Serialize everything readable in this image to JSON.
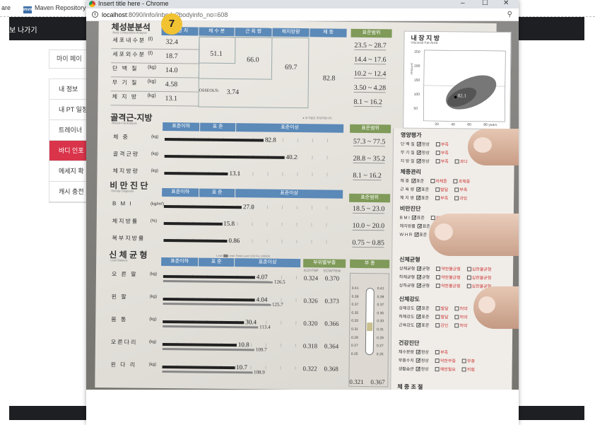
{
  "background_page": {
    "bookmarks": [
      "are",
      "Maven Repository"
    ],
    "maven_icon_text": "mvn",
    "nav_text": "보 나가기",
    "my_page": "마이 페이",
    "menu": [
      {
        "label": "내 정보",
        "active": false
      },
      {
        "label": "내 PT 일정",
        "active": false
      },
      {
        "label": "트레이너",
        "active": false
      },
      {
        "label": "바디 인포",
        "active": true
      },
      {
        "label": "메세지 확",
        "active": false
      },
      {
        "label": "캐시 충전",
        "active": false
      }
    ]
  },
  "popup": {
    "window_title": "Insert title here - Chrome",
    "window_controls": [
      "–",
      "☐",
      "✕"
    ],
    "url_host": "localhost",
    "url_path": ":8090/info/inbody?bodyinfo_no=608",
    "badge": "7"
  },
  "sheet": {
    "body_composition": {
      "title": "체성분분석",
      "subtitle": "Body Composition Analysis",
      "headers": [
        "측 정 치",
        "체 수 분",
        "근 육 량",
        "체지방량",
        "체 중",
        "표준범위"
      ],
      "rows": [
        {
          "label": "세포내수분",
          "unit": "(ℓ)",
          "value": "32.4"
        },
        {
          "label": "세포외수분",
          "unit": "(ℓ)",
          "value": "18.7"
        },
        {
          "label": "단 백 질",
          "unit": "(kg)",
          "value": "14.0"
        },
        {
          "label": "무 기 질",
          "unit": "(kg)",
          "value": "4.58"
        },
        {
          "label": "체 지 방",
          "unit": "(kg)",
          "value": "13.1"
        }
      ],
      "water": "51.1",
      "muscle": "66.0",
      "fat_free": "69.7",
      "weight": "82.8",
      "osseous_label": "OSSEOUS:",
      "osseous": "3.74",
      "ranges": [
        "23.5 ~ 28.7",
        "14.4 ~ 17.6",
        "10.2 ~ 12.4",
        "3.50 ~ 4.28",
        "8.1 ~ 16.2"
      ]
    },
    "muscle_fat": {
      "title": "골격근-지방",
      "subtitle": "Muscle-Fat Analysis",
      "headers": [
        "표준이하",
        "표 준",
        "표준이상",
        "표준범위"
      ],
      "note": "● 부가질은 추정치입니다.",
      "rows": [
        {
          "label": "체 중",
          "unit": "(kg)",
          "value": "82.8",
          "fill": 0.56,
          "range": "57.3 ~ 77.5"
        },
        {
          "label": "골격근량",
          "unit": "(kg)",
          "value": "40.2",
          "fill": 0.68,
          "range": "28.8 ~ 35.2"
        },
        {
          "label": "체지방량",
          "unit": "(kg)",
          "value": "13.1",
          "fill": 0.36,
          "range": "8.1 ~ 16.2"
        }
      ]
    },
    "obesity": {
      "title": "비 만 진 단",
      "subtitle": "Obesity Diagnosis",
      "headers": [
        "표준이하",
        "표 준",
        "표준이상",
        "표준범위"
      ],
      "rows": [
        {
          "label": "B M I",
          "unit": "(kg/m²)",
          "value": "27.0",
          "fill": 0.44,
          "range": "18.5 ~ 23.0"
        },
        {
          "label": "체지방률",
          "unit": "(%)",
          "value": "15.8",
          "fill": 0.33,
          "range": "10.0 ~ 20.0"
        },
        {
          "label": "복부지방률",
          "unit": "",
          "value": "0.86",
          "fill": 0.36,
          "range": "0.75 ~ 0.85"
        }
      ]
    },
    "balance": {
      "title": "신 체 균 형",
      "subtitle": "Lean Balance",
      "headers": [
        "표준이하",
        "표 준",
        "표준이상",
        "부위별부종",
        "부 종"
      ],
      "legend": "Lean ▇▇ Lean Total Lean+100 Fix 100000",
      "col_labels": [
        "ECF/TBF",
        "ECW/TBW"
      ],
      "rows": [
        {
          "label": "오 른 팔",
          "unit": "(kg)",
          "value": "4.07",
          "value2": "126.5",
          "fill": 0.52,
          "fill2": 0.62,
          "ecf": "0.324",
          "ecw": "0.370"
        },
        {
          "label": "왼 팔",
          "unit": "(kg)",
          "value": "4.04",
          "value2": "125.7",
          "fill": 0.52,
          "fill2": 0.61,
          "ecf": "0.326",
          "ecw": "0.373"
        },
        {
          "label": "몸 통",
          "unit": "(kg)",
          "value": "30.4",
          "value2": "113.4",
          "fill": 0.46,
          "fill2": 0.54,
          "ecf": "0.320",
          "ecw": "0.366"
        },
        {
          "label": "오른다리",
          "unit": "(kg)",
          "value": "10.8",
          "value2": "109.7",
          "fill": 0.42,
          "fill2": 0.52,
          "ecf": "0.318",
          "ecw": "0.364"
        },
        {
          "label": "왼 다 리",
          "unit": "(kg)",
          "value": "10.7",
          "value2": "108.9",
          "fill": 0.41,
          "fill2": 0.51,
          "ecf": "0.322",
          "ecw": "0.368"
        }
      ],
      "fluid_scale": [
        "0.41",
        "0.40",
        "0.39",
        "0.38",
        "0.37",
        "0.36",
        "0.35",
        "0.34",
        "0.33",
        "0.32",
        "0.31",
        "0.30",
        "0.29",
        "0.28",
        "0.27",
        "0.26",
        "0.25"
      ],
      "fluid_totals": [
        "0.321",
        "0.367"
      ]
    },
    "visceral": {
      "title": "내 장 지 방",
      "subtitle": "Visceral Fat Area",
      "y_ticks": [
        "250",
        "200",
        "150",
        "100",
        "50"
      ],
      "y_axis": "VFA(cm²)",
      "x_ticks": [
        "20",
        "40",
        "60",
        "80"
      ],
      "x_unit": "years",
      "point_label": "82.1"
    },
    "nutrition": {
      "title": "영양평가",
      "rows": [
        {
          "label": "단 백 질",
          "checks": [
            "정상",
            "부족"
          ]
        },
        {
          "label": "무 기 질",
          "checks": [
            "정상",
            "부족"
          ]
        },
        {
          "label": "지 방 질",
          "checks": [
            "정상",
            "부족",
            "과다"
          ]
        }
      ]
    },
    "weight_mgmt": {
      "title": "체중관리",
      "rows": [
        {
          "label": "체 중",
          "checks": [
            "표준",
            "저체중",
            "과체중"
          ]
        },
        {
          "label": "근 육 량",
          "checks": [
            "표준",
            "발달",
            "부족"
          ]
        },
        {
          "label": "체 지 방",
          "checks": [
            "표준",
            "부족",
            "과잉"
          ]
        }
      ]
    },
    "obesity_dx": {
      "title": "비만진단",
      "rows": [
        {
          "label": "B M I",
          "checks": [
            "표준",
            "저",
            "과체중"
          ]
        },
        {
          "label": "체지방률",
          "checks": [
            "표준"
          ]
        },
        {
          "label": "W H R",
          "checks": [
            "표준"
          ]
        }
      ]
    },
    "balance_dx": {
      "title": "신체균형",
      "rows": [
        {
          "label": "상체균형",
          "checks": [
            "균형",
            "약한불균형",
            "심한불균형"
          ]
        },
        {
          "label": "하체균형",
          "checks": [
            "균형",
            "약한불균형",
            "심한불균형"
          ]
        },
        {
          "label": "상하균형",
          "checks": [
            "균형",
            "약한불균형",
            "심한불균형"
          ]
        }
      ]
    },
    "strength": {
      "title": "신체강도",
      "rows": [
        {
          "label": "상체강도",
          "checks": [
            "표준",
            "발달",
            "허약"
          ]
        },
        {
          "label": "하체강도",
          "checks": [
            "표준",
            "발달",
            "허약"
          ]
        },
        {
          "label": "근육강도",
          "checks": [
            "표준",
            "강인",
            "허약"
          ]
        }
      ]
    },
    "health": {
      "title": "건강진단",
      "rows": [
        {
          "label": "체수분량",
          "checks": [
            "정상",
            "부족"
          ]
        },
        {
          "label": "부종수치",
          "checks": [
            "정상",
            "약한부종",
            "부종"
          ]
        },
        {
          "label": "생활습관",
          "checks": [
            "정상",
            "예방필요",
            "위험"
          ]
        }
      ],
      "trailing": "체 중 조 절"
    }
  }
}
